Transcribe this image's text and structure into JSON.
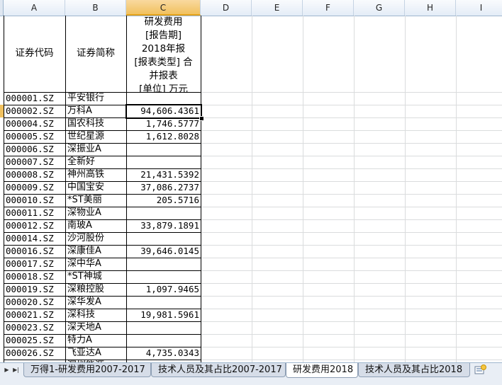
{
  "columns": [
    "A",
    "B",
    "C",
    "D",
    "E",
    "F",
    "G",
    "H",
    "I"
  ],
  "selected_column": "C",
  "header_row": {
    "a": "证券代码",
    "b": "证券简称",
    "c_lines": [
      "研发费用",
      "[报告期]",
      "2018年报",
      "[报表类型] 合",
      "并报表",
      "[单位] 万元"
    ]
  },
  "rows": [
    {
      "code": "000001.SZ",
      "name": "平安银行",
      "value": ""
    },
    {
      "code": "000002.SZ",
      "name": "万科A",
      "value": "94,606.4361"
    },
    {
      "code": "000004.SZ",
      "name": "国农科技",
      "value": "1,746.5777"
    },
    {
      "code": "000005.SZ",
      "name": "世纪星源",
      "value": "1,612.8028"
    },
    {
      "code": "000006.SZ",
      "name": "深振业A",
      "value": ""
    },
    {
      "code": "000007.SZ",
      "name": "全新好",
      "value": ""
    },
    {
      "code": "000008.SZ",
      "name": "神州高铁",
      "value": "21,431.5392"
    },
    {
      "code": "000009.SZ",
      "name": "中国宝安",
      "value": "37,086.2737"
    },
    {
      "code": "000010.SZ",
      "name": "*ST美丽",
      "value": "205.5716"
    },
    {
      "code": "000011.SZ",
      "name": "深物业A",
      "value": ""
    },
    {
      "code": "000012.SZ",
      "name": "南玻A",
      "value": "33,879.1891"
    },
    {
      "code": "000014.SZ",
      "name": "沙河股份",
      "value": ""
    },
    {
      "code": "000016.SZ",
      "name": "深康佳A",
      "value": "39,646.0145"
    },
    {
      "code": "000017.SZ",
      "name": "深中华A",
      "value": ""
    },
    {
      "code": "000018.SZ",
      "name": "*ST神城",
      "value": ""
    },
    {
      "code": "000019.SZ",
      "name": "深粮控股",
      "value": "1,097.9465"
    },
    {
      "code": "000020.SZ",
      "name": "深华发A",
      "value": ""
    },
    {
      "code": "000021.SZ",
      "name": "深科技",
      "value": "19,981.5961"
    },
    {
      "code": "000023.SZ",
      "name": "深天地A",
      "value": ""
    },
    {
      "code": "000025.SZ",
      "name": "特力A",
      "value": ""
    },
    {
      "code": "000026.SZ",
      "name": "飞亚达A",
      "value": "4,735.0343"
    },
    {
      "code": "",
      "name": "深圳能源",
      "value": ""
    }
  ],
  "active_row_index": 1,
  "sheet_tabs": [
    {
      "label": "万得1-研发费用2007-2017",
      "active": false
    },
    {
      "label": "技术人员及其占比2007-2017",
      "active": false
    },
    {
      "label": "研发费用2018",
      "active": true
    },
    {
      "label": "技术人员及其占比2018",
      "active": false
    }
  ],
  "icons": {
    "nav_next": "play-right-icon",
    "nav_last": "skip-last-icon",
    "new_sheet": "insert-worksheet-icon"
  }
}
